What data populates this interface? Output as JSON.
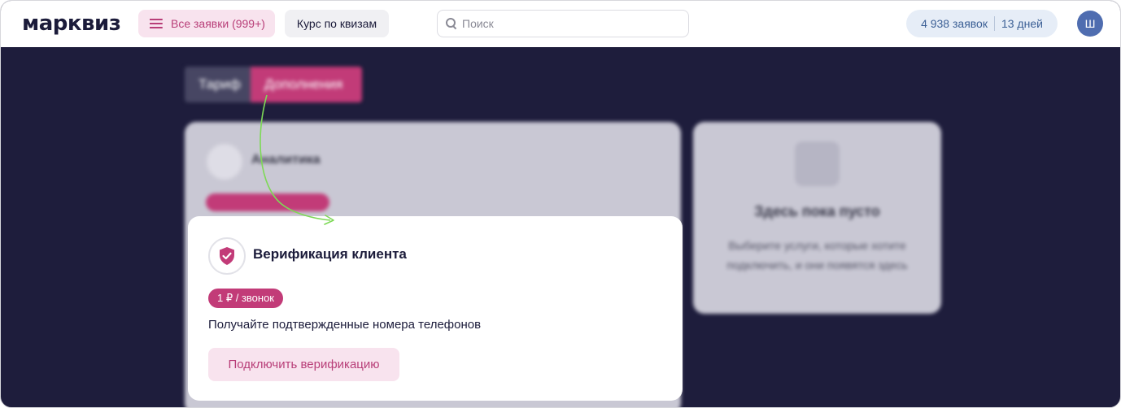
{
  "header": {
    "logo": "марквиз",
    "requests_button": "Все заявки (999+)",
    "course_button": "Курс по квизам",
    "search_placeholder": "Поиск",
    "stats_requests": "4 938 заявок",
    "stats_days": "13 дней",
    "avatar_letter": "Ш"
  },
  "tabs": [
    {
      "label": "Тариф",
      "active": false
    },
    {
      "label": "Дополнения",
      "active": true
    }
  ],
  "background_cards": {
    "analytics_title": "Аналитика",
    "empty_title": "Здесь пока пусто",
    "empty_text": "Выберите услуги, которые хотите подключить, и они появятся здесь"
  },
  "verification_card": {
    "icon": "shield-check-icon",
    "title": "Верификация клиента",
    "price": "1 ₽ / звонок",
    "description": "Получайте подтвержденные номера телефонов",
    "button": "Подключить верификацию"
  },
  "colors": {
    "accent": "#c23b78",
    "accent_light": "#f8e3ee",
    "background_dark": "#1e1d3c",
    "arrow": "#7ed957"
  }
}
